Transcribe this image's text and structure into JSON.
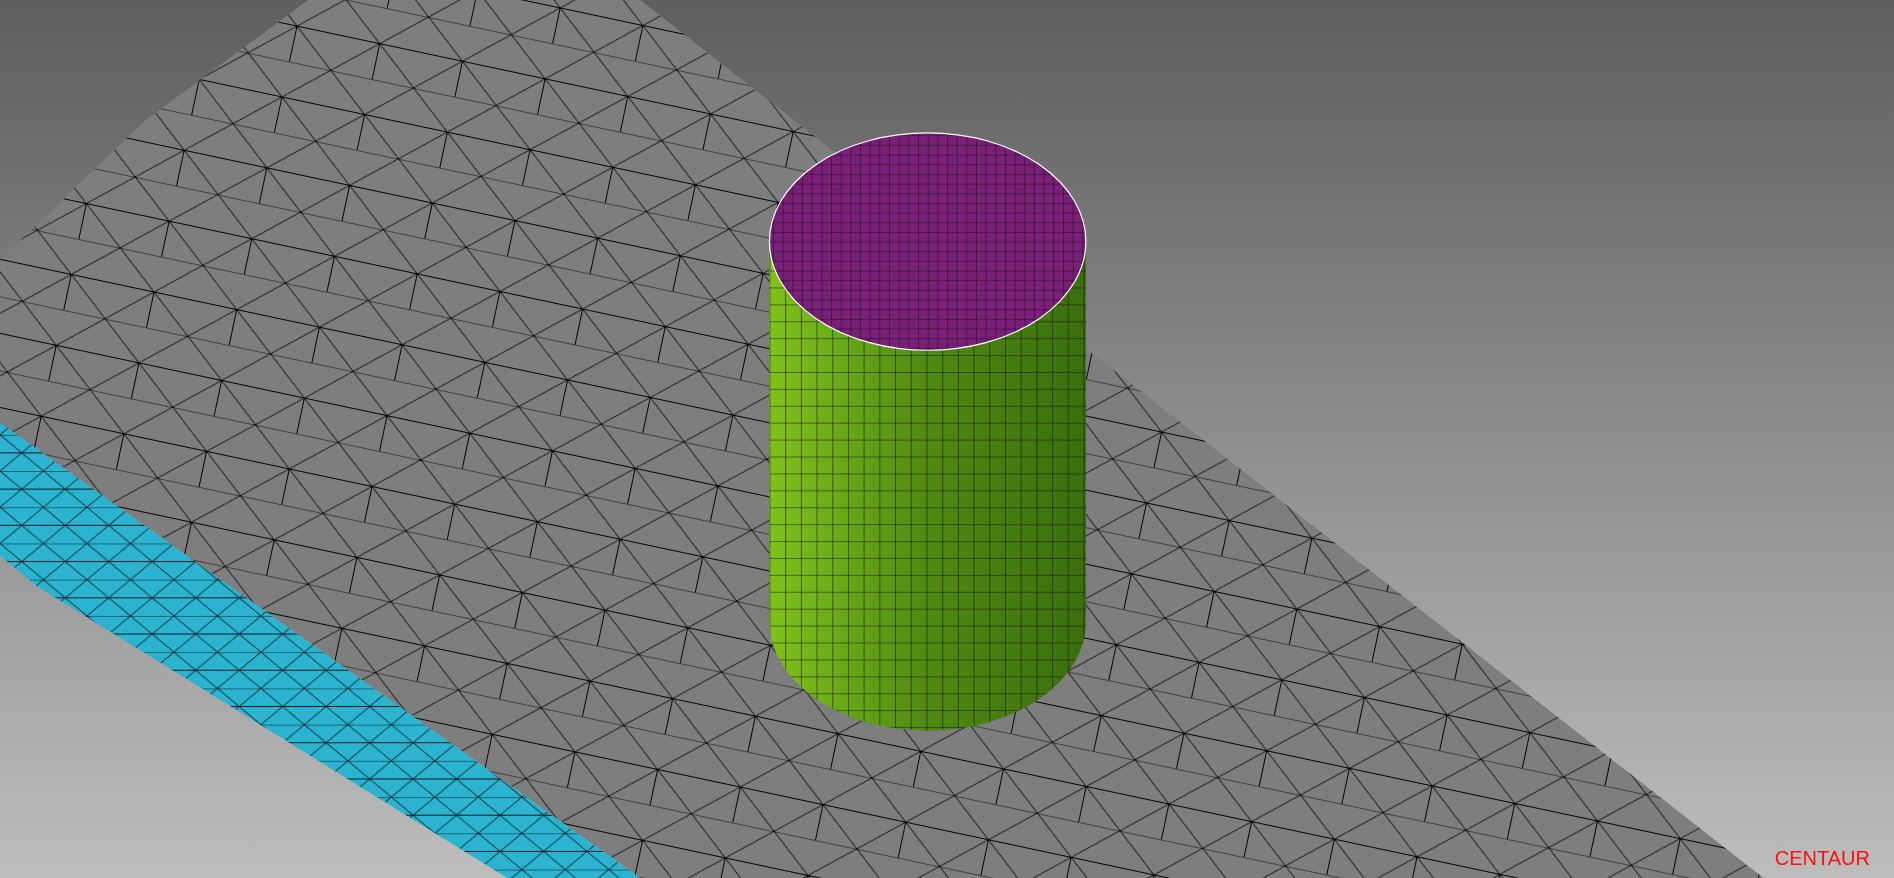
{
  "viewport": {
    "label": "CENTAUR"
  }
}
